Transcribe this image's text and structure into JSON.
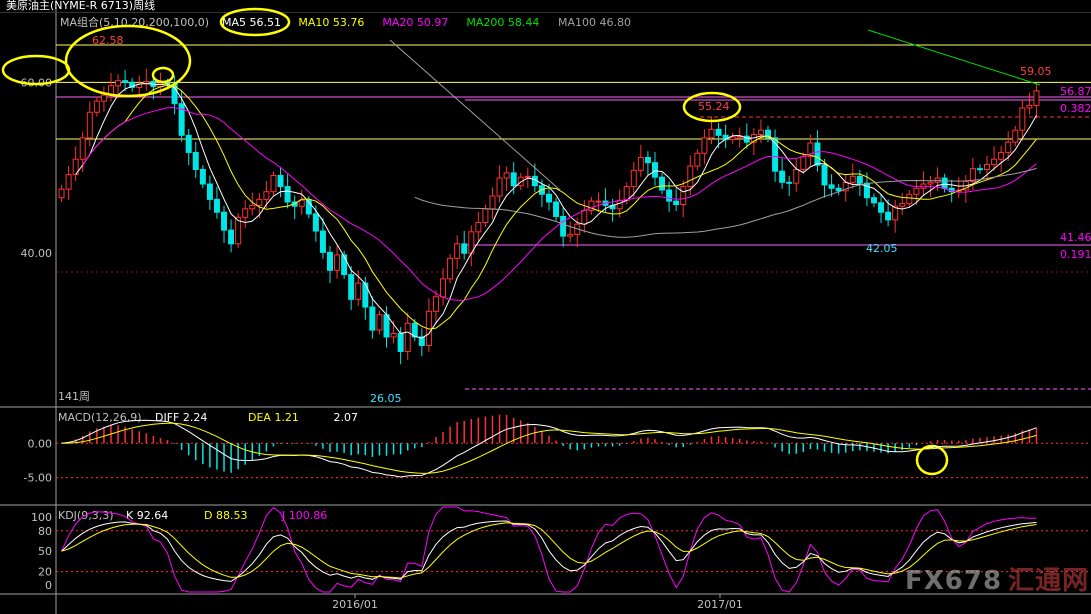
{
  "chart_data": [
    {
      "type": "candlestick",
      "title": "美原油主(NYME-R 6713)周线",
      "period_label": "141周",
      "ma_label": "MA组合(5,10,20,200,100,0)",
      "ma_values": [
        {
          "name": "MA5",
          "value": "56.51",
          "color": "#ffffff"
        },
        {
          "name": "MA10",
          "value": "53.76",
          "color": "#ffff00"
        },
        {
          "name": "MA20",
          "value": "50.97",
          "color": "#ff00ff"
        },
        {
          "name": "MA200",
          "value": "58.44",
          "color": "#00e000"
        },
        {
          "name": "MA100",
          "value": "46.80",
          "color": "#a0a0a0"
        }
      ],
      "y_ticks": [
        "60.00",
        "40.00"
      ],
      "ylim": [
        22,
        68
      ],
      "x_ticks": [
        "2016/01",
        "2017/01"
      ],
      "annotations": {
        "high_left": "62.58",
        "high_mid": "55.24",
        "low": "26.05",
        "low_mid": "42.05",
        "last_high": "59.05",
        "levels": [
          {
            "value": "56.87",
            "color": "#ff00ff"
          },
          {
            "value": "0.382",
            "color": "#ff00ff"
          },
          {
            "value": "41.46",
            "color": "#ff00ff"
          },
          {
            "value": "0.191",
            "color": "#ff00ff"
          }
        ]
      },
      "closes": [
        47.5,
        49.2,
        51.0,
        53.5,
        56.5,
        57.8,
        58.5,
        59.6,
        60.2,
        60.0,
        59.4,
        59.8,
        60.1,
        59.5,
        59.9,
        59.8,
        57.5,
        53.8,
        51.8,
        49.8,
        48.1,
        46.3,
        44.8,
        42.7,
        41.1,
        44.2,
        45.2,
        45.6,
        46.3,
        47.2,
        49.1,
        47.8,
        46.0,
        45.5,
        46.2,
        44.6,
        42.6,
        40.1,
        38.0,
        39.8,
        37.5,
        34.6,
        36.5,
        33.7,
        31.0,
        32.8,
        30.2,
        30.6,
        28.5,
        31.8,
        30.2,
        29.2,
        33.2,
        34.9,
        37.0,
        39.4,
        41.1,
        40.0,
        42.5,
        43.6,
        45.2,
        46.7,
        48.8,
        49.4,
        47.9,
        48.9,
        49.0,
        47.9,
        46.9,
        46.0,
        44.3,
        42.0,
        42.2,
        43.4,
        45.0,
        46.1,
        46.1,
        45.6,
        45.2,
        46.2,
        47.8,
        49.7,
        51.2,
        50.6,
        48.9,
        47.4,
        46.1,
        45.7,
        47.8,
        50.2,
        51.7,
        53.5,
        54.5,
        53.8,
        53.3,
        53.6,
        53.7,
        53.0,
        53.9,
        54.4,
        53.5,
        49.6,
        48.3,
        48.2,
        49.8,
        51.3,
        52.9,
        50.3,
        48.0,
        47.6,
        47.3,
        48.3,
        49.0,
        48.2,
        46.5,
        45.9,
        44.8,
        43.9,
        45.5,
        45.8,
        46.9,
        47.6,
        48.1,
        48.3,
        48.8,
        47.6,
        47.2,
        47.4,
        48.4,
        49.9,
        49.8,
        50.4,
        51.0,
        51.8,
        53.0,
        54.4,
        57.0,
        57.3,
        59.0
      ],
      "series": [
        {
          "name": "MA5",
          "color": "#ffffff"
        },
        {
          "name": "MA10",
          "color": "#ffff00"
        },
        {
          "name": "MA20",
          "color": "#ff00ff"
        },
        {
          "name": "MA100",
          "color": "#a0a0a0"
        },
        {
          "name": "MA200",
          "color": "#00e000"
        }
      ]
    },
    {
      "type": "bar",
      "title": "MACD(12,26,9)",
      "labels": [
        {
          "name": "DIFF",
          "value": "2.24",
          "color": "#ffffff"
        },
        {
          "name": "DEA",
          "value": "1.21",
          "color": "#ffff00"
        },
        {
          "name": "",
          "value": "2.07",
          "color": "#ffffff"
        }
      ],
      "y_ticks": [
        "0.00",
        "-5.00"
      ],
      "ylim": [
        -9,
        5
      ]
    },
    {
      "type": "line",
      "title": "KDJ(9,3,3)",
      "labels": [
        {
          "name": "K",
          "value": "92.64",
          "color": "#ffffff"
        },
        {
          "name": "D",
          "value": "88.53",
          "color": "#ffff00"
        },
        {
          "name": "J",
          "value": "100.86",
          "color": "#ff00ff"
        }
      ],
      "y_ticks": [
        "100",
        "80",
        "50",
        "20",
        "0"
      ],
      "ylim": [
        -10,
        115
      ]
    }
  ],
  "watermark": {
    "text": "FX678",
    "cn": "汇通网"
  }
}
